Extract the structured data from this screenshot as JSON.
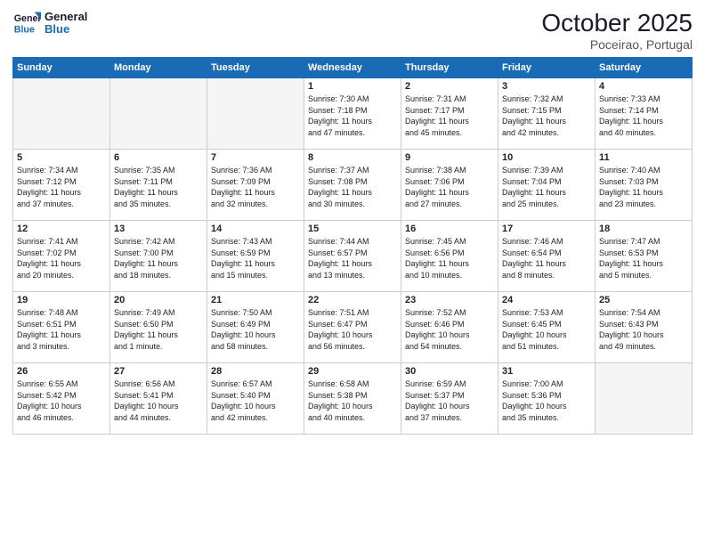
{
  "header": {
    "logo_line1": "General",
    "logo_line2": "Blue",
    "month": "October 2025",
    "location": "Poceirao, Portugal"
  },
  "weekdays": [
    "Sunday",
    "Monday",
    "Tuesday",
    "Wednesday",
    "Thursday",
    "Friday",
    "Saturday"
  ],
  "weeks": [
    [
      {
        "day": "",
        "info": "",
        "empty": true
      },
      {
        "day": "",
        "info": "",
        "empty": true
      },
      {
        "day": "",
        "info": "",
        "empty": true
      },
      {
        "day": "1",
        "info": "Sunrise: 7:30 AM\nSunset: 7:18 PM\nDaylight: 11 hours\nand 47 minutes."
      },
      {
        "day": "2",
        "info": "Sunrise: 7:31 AM\nSunset: 7:17 PM\nDaylight: 11 hours\nand 45 minutes."
      },
      {
        "day": "3",
        "info": "Sunrise: 7:32 AM\nSunset: 7:15 PM\nDaylight: 11 hours\nand 42 minutes."
      },
      {
        "day": "4",
        "info": "Sunrise: 7:33 AM\nSunset: 7:14 PM\nDaylight: 11 hours\nand 40 minutes."
      }
    ],
    [
      {
        "day": "5",
        "info": "Sunrise: 7:34 AM\nSunset: 7:12 PM\nDaylight: 11 hours\nand 37 minutes."
      },
      {
        "day": "6",
        "info": "Sunrise: 7:35 AM\nSunset: 7:11 PM\nDaylight: 11 hours\nand 35 minutes."
      },
      {
        "day": "7",
        "info": "Sunrise: 7:36 AM\nSunset: 7:09 PM\nDaylight: 11 hours\nand 32 minutes."
      },
      {
        "day": "8",
        "info": "Sunrise: 7:37 AM\nSunset: 7:08 PM\nDaylight: 11 hours\nand 30 minutes."
      },
      {
        "day": "9",
        "info": "Sunrise: 7:38 AM\nSunset: 7:06 PM\nDaylight: 11 hours\nand 27 minutes."
      },
      {
        "day": "10",
        "info": "Sunrise: 7:39 AM\nSunset: 7:04 PM\nDaylight: 11 hours\nand 25 minutes."
      },
      {
        "day": "11",
        "info": "Sunrise: 7:40 AM\nSunset: 7:03 PM\nDaylight: 11 hours\nand 23 minutes."
      }
    ],
    [
      {
        "day": "12",
        "info": "Sunrise: 7:41 AM\nSunset: 7:02 PM\nDaylight: 11 hours\nand 20 minutes."
      },
      {
        "day": "13",
        "info": "Sunrise: 7:42 AM\nSunset: 7:00 PM\nDaylight: 11 hours\nand 18 minutes."
      },
      {
        "day": "14",
        "info": "Sunrise: 7:43 AM\nSunset: 6:59 PM\nDaylight: 11 hours\nand 15 minutes."
      },
      {
        "day": "15",
        "info": "Sunrise: 7:44 AM\nSunset: 6:57 PM\nDaylight: 11 hours\nand 13 minutes."
      },
      {
        "day": "16",
        "info": "Sunrise: 7:45 AM\nSunset: 6:56 PM\nDaylight: 11 hours\nand 10 minutes."
      },
      {
        "day": "17",
        "info": "Sunrise: 7:46 AM\nSunset: 6:54 PM\nDaylight: 11 hours\nand 8 minutes."
      },
      {
        "day": "18",
        "info": "Sunrise: 7:47 AM\nSunset: 6:53 PM\nDaylight: 11 hours\nand 5 minutes."
      }
    ],
    [
      {
        "day": "19",
        "info": "Sunrise: 7:48 AM\nSunset: 6:51 PM\nDaylight: 11 hours\nand 3 minutes."
      },
      {
        "day": "20",
        "info": "Sunrise: 7:49 AM\nSunset: 6:50 PM\nDaylight: 11 hours\nand 1 minute."
      },
      {
        "day": "21",
        "info": "Sunrise: 7:50 AM\nSunset: 6:49 PM\nDaylight: 10 hours\nand 58 minutes."
      },
      {
        "day": "22",
        "info": "Sunrise: 7:51 AM\nSunset: 6:47 PM\nDaylight: 10 hours\nand 56 minutes."
      },
      {
        "day": "23",
        "info": "Sunrise: 7:52 AM\nSunset: 6:46 PM\nDaylight: 10 hours\nand 54 minutes."
      },
      {
        "day": "24",
        "info": "Sunrise: 7:53 AM\nSunset: 6:45 PM\nDaylight: 10 hours\nand 51 minutes."
      },
      {
        "day": "25",
        "info": "Sunrise: 7:54 AM\nSunset: 6:43 PM\nDaylight: 10 hours\nand 49 minutes."
      }
    ],
    [
      {
        "day": "26",
        "info": "Sunrise: 6:55 AM\nSunset: 5:42 PM\nDaylight: 10 hours\nand 46 minutes."
      },
      {
        "day": "27",
        "info": "Sunrise: 6:56 AM\nSunset: 5:41 PM\nDaylight: 10 hours\nand 44 minutes."
      },
      {
        "day": "28",
        "info": "Sunrise: 6:57 AM\nSunset: 5:40 PM\nDaylight: 10 hours\nand 42 minutes."
      },
      {
        "day": "29",
        "info": "Sunrise: 6:58 AM\nSunset: 5:38 PM\nDaylight: 10 hours\nand 40 minutes."
      },
      {
        "day": "30",
        "info": "Sunrise: 6:59 AM\nSunset: 5:37 PM\nDaylight: 10 hours\nand 37 minutes."
      },
      {
        "day": "31",
        "info": "Sunrise: 7:00 AM\nSunset: 5:36 PM\nDaylight: 10 hours\nand 35 minutes."
      },
      {
        "day": "",
        "info": "",
        "empty": true
      }
    ]
  ]
}
